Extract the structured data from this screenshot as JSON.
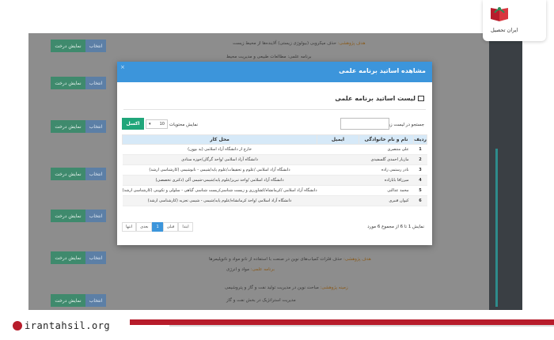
{
  "background": {
    "rows": [
      {
        "show": "نمایش درخت",
        "select": "انتخاب"
      },
      {
        "show": "نمایش درخت",
        "select": "انتخاب"
      },
      {
        "show": "نمایش درخت",
        "select": "انتخاب"
      },
      {
        "show": "نمایش درخت",
        "select": "انتخاب"
      },
      {
        "show": "نمایش درخت",
        "select": "انتخاب"
      },
      {
        "show": "نمایش درخت",
        "select": "انتخاب"
      },
      {
        "show": "نمایش درخت",
        "select": "انتخاب"
      }
    ],
    "texts": [
      {
        "label": "هدف پژوهشی:",
        "body": "حذف میکروبی (بیولوژی زیستی) آلاینده‌ها از محیط زیست"
      },
      {
        "label": "",
        "body": "برنامه علمی: مطالعات طبیعی و مدیریت محیط"
      },
      {
        "label": "هدف پژوهشی:",
        "body": "حذف فلزات کمیاب‌های نوین در صنعت با استفاده از نانو مواد و نانوپلیمرها"
      },
      {
        "label": "برنامه علمی:",
        "body": "مواد و انرژی"
      },
      {
        "label": "زمینه پژوهشی:",
        "body": "مباحث نوین در مدیریت تولید نفت و گاز و پتروشیمی"
      },
      {
        "label": "",
        "body": "مدیریت استراتژیک در بخش نفت و گاز"
      }
    ],
    "scroll_icon": "arrow-up-icon"
  },
  "modal": {
    "title": "مشاهده اساتید برنامه علمی",
    "close": "×",
    "subtitle": "لیست اساتید برنامه علمی",
    "search_label": "جستجو در لیست زیر",
    "search_value": "",
    "show_label": "نمایش محتویات",
    "page_size": "10",
    "excel_button": "اکسل",
    "columns": [
      "ردیف",
      "نام و نام خانوادگی",
      "ایمیل",
      "محل کار"
    ],
    "rows": [
      {
        "num": "1",
        "name": "علی منتصری",
        "email": "",
        "work": "خارج از دانشگاه آزاد اسلامی (ید بوون)"
      },
      {
        "num": "2",
        "name": "مازیار احمدی گلسفیدی",
        "email": "",
        "work": "دانشگاه آزاد اسلامی /واحد گرگان/حوزه ستادی"
      },
      {
        "num": "3",
        "name": "نادر رستمی زاده",
        "email": "",
        "work": "دانشگاه آزاد اسلامی /علوم و تحقیقات/علوم پایه/شیمی - نانوشیمی (کارشناسی ارشد)"
      },
      {
        "num": "4",
        "name": "میرزاقا بابازاده",
        "email": "",
        "work": "دانشگاه آزاد اسلامی /واحد تبریز/علوم پایه/شیمی-شیمی آلی (دکتری تخصصی)"
      },
      {
        "num": "5",
        "name": "محمد عدالتی",
        "email": "",
        "work": "دانشگاه آزاد اسلامی /کرمانشاه/کشاورزی و زیست شناسی/زیست شناسی گیاهی - سلولی و تکوینی (کارشناسی ارشد)"
      },
      {
        "num": "6",
        "name": "کیوان قنبری",
        "email": "",
        "work": "دانشگاه آزاد اسلامی /واحد کرمانشاه/علوم پایه/شیمی - شیمی تجزیه (کارشناسی ارشد)"
      }
    ],
    "info": "نمایش 1 تا 6 از مجموع 6 مورد",
    "pager": [
      "ابتدا",
      "قبلی",
      "1",
      "بعدی",
      "انتها"
    ],
    "pager_active": "1"
  },
  "branding": {
    "site": "irantahsil.org",
    "logo_text": "ایران تحصیل",
    "red": "#b71c2b"
  }
}
